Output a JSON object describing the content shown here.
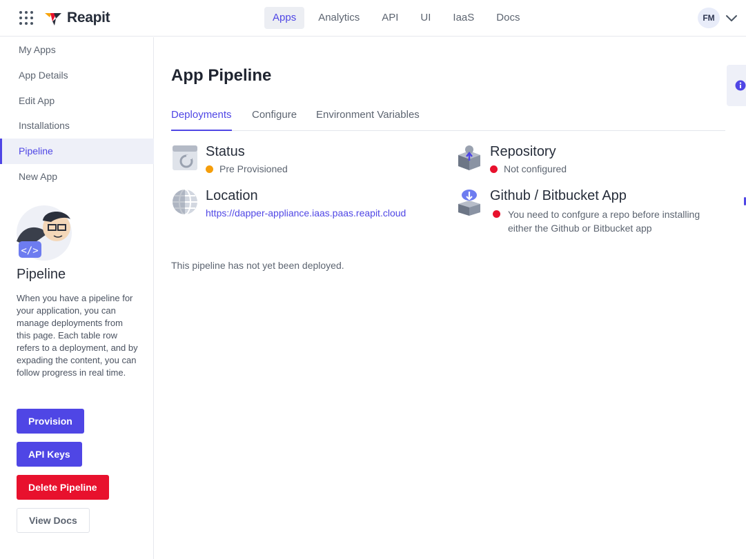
{
  "header": {
    "brand": "Reapit",
    "nav": [
      {
        "label": "Apps",
        "active": true
      },
      {
        "label": "Analytics",
        "active": false
      },
      {
        "label": "API",
        "active": false
      },
      {
        "label": "UI",
        "active": false
      },
      {
        "label": "IaaS",
        "active": false
      },
      {
        "label": "Docs",
        "active": false
      }
    ],
    "avatar_initials": "FM"
  },
  "sidebar": {
    "items": [
      {
        "label": "My Apps",
        "active": false
      },
      {
        "label": "App Details",
        "active": false
      },
      {
        "label": "Edit App",
        "active": false
      },
      {
        "label": "Installations",
        "active": false
      },
      {
        "label": "Pipeline",
        "active": true
      },
      {
        "label": "New App",
        "active": false
      }
    ],
    "panel_title": "Pipeline",
    "panel_description": "When you have a pipeline for your application, you can manage deployments from this page. Each table row refers to a deployment, and by expading the content, you can follow progress in real time.",
    "buttons": {
      "provision": "Provision",
      "api_keys": "API Keys",
      "delete_pipeline": "Delete Pipeline",
      "view_docs": "View Docs"
    }
  },
  "main": {
    "title": "App Pipeline",
    "tabs": [
      {
        "label": "Deployments",
        "active": true
      },
      {
        "label": "Configure",
        "active": false
      },
      {
        "label": "Environment Variables",
        "active": false
      }
    ],
    "status": {
      "title": "Status",
      "value": "Pre Provisioned",
      "dot_color": "#f59e0b"
    },
    "repository": {
      "title": "Repository",
      "value": "Not configured",
      "dot_color": "#e8112d"
    },
    "location": {
      "title": "Location",
      "value": "https://dapper-appliance.iaas.paas.reapit.cloud"
    },
    "github_app": {
      "title": "Github / Bitbucket App",
      "value": "You need to confgure a repo before installing either the Github or Bitbucket app",
      "dot_color": "#e8112d"
    },
    "empty_message": "This pipeline has not yet been deployed."
  },
  "colors": {
    "accent": "#4f46e5",
    "danger": "#e8112d",
    "warning": "#f59e0b"
  }
}
